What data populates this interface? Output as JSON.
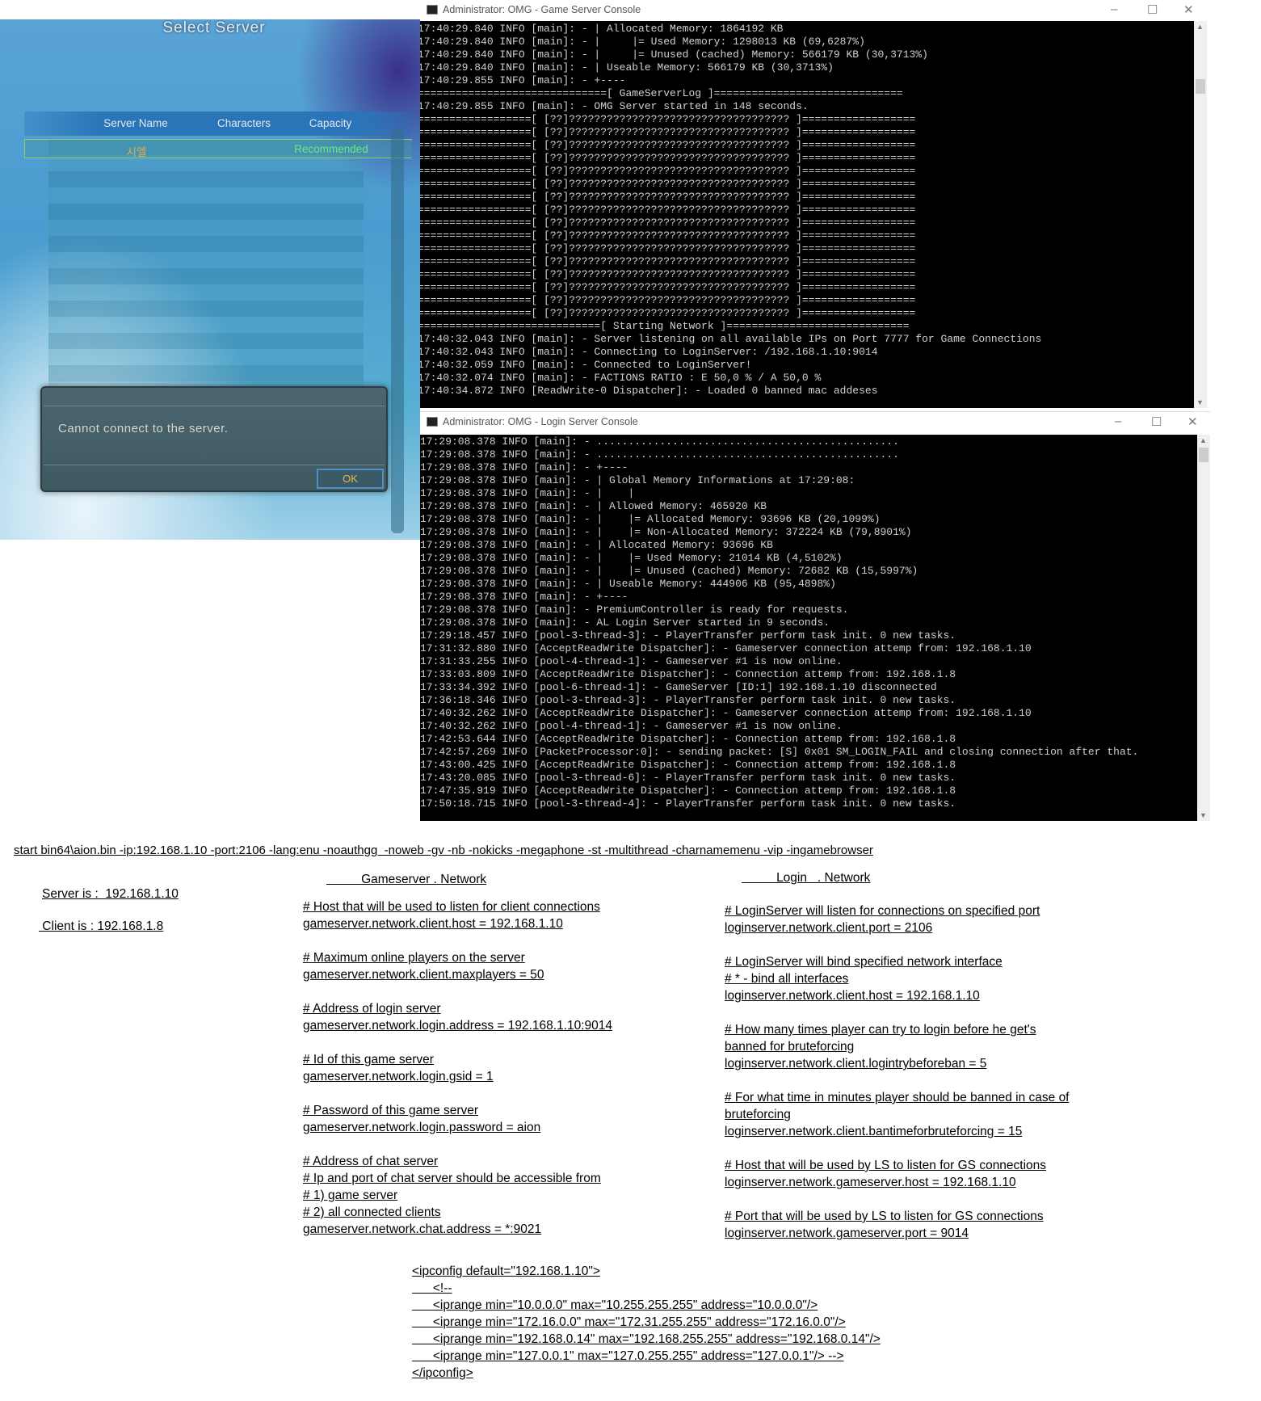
{
  "game": {
    "title": "Select Server",
    "columns": [
      "Server Name",
      "Characters",
      "Capacity"
    ],
    "server_name": "시엘",
    "server_status": "Recommended",
    "dialog_message": "Cannot connect to the server.",
    "ok_label": "OK"
  },
  "gs_console": {
    "title": "Administrator:  OMG - Game Server Console",
    "lines": [
      "17:40:29.840 INFO [main]: - | Allocated Memory: 1864192 KB",
      "17:40:29.840 INFO [main]: - |     |= Used Memory: 1298013 KB (69,6287%)",
      "17:40:29.840 INFO [main]: - |     |= Unused (cached) Memory: 566179 KB (30,3713%)",
      "17:40:29.840 INFO [main]: - | Useable Memory: 566179 KB (30,3713%)",
      "17:40:29.855 INFO [main]: - +----",
      "==============================[ GameServerLog ]==============================",
      "17:40:29.855 INFO [main]: - OMG Server started in 148 seconds.",
      "==================[ [??]??????????????????????????????????? ]==================",
      "==================[ [??]??????????????????????????????????? ]==================",
      "==================[ [??]??????????????????????????????????? ]==================",
      "==================[ [??]??????????????????????????????????? ]==================",
      "==================[ [??]??????????????????????????????????? ]==================",
      "==================[ [??]??????????????????????????????????? ]==================",
      "==================[ [??]??????????????????????????????????? ]==================",
      "==================[ [??]??????????????????????????????????? ]==================",
      "==================[ [??]??????????????????????????????????? ]==================",
      "==================[ [??]??????????????????????????????????? ]==================",
      "==================[ [??]??????????????????????????????????? ]==================",
      "==================[ [??]??????????????????????????????????? ]==================",
      "==================[ [??]??????????????????????????????????? ]==================",
      "==================[ [??]??????????????????????????????????? ]==================",
      "==================[ [??]??????????????????????????????????? ]==================",
      "==================[ [??]??????????????????????????????????? ]==================",
      "=============================[ Starting Network ]=============================",
      "17:40:32.043 INFO [main]: - Server listening on all available IPs on Port 7777 for Game Connections",
      "17:40:32.043 INFO [main]: - Connecting to LoginServer: /192.168.1.10:9014",
      "17:40:32.059 INFO [main]: - Connected to LoginServer!",
      "17:40:32.074 INFO [main]: - FACTIONS RATIO : E 50,0 % / A 50,0 %",
      "17:40:34.872 INFO [ReadWrite-0 Dispatcher]: - Loaded 0 banned mac addeses"
    ]
  },
  "ls_console": {
    "title": "Administrator:  OMG - Login Server Console",
    "lines": [
      "17:29:08.378 INFO [main]: - ................................................",
      "17:29:08.378 INFO [main]: - ................................................",
      "17:29:08.378 INFO [main]: - +----",
      "17:29:08.378 INFO [main]: - | Global Memory Informations at 17:29:08:",
      "17:29:08.378 INFO [main]: - |    |",
      "17:29:08.378 INFO [main]: - | Allowed Memory: 465920 KB",
      "17:29:08.378 INFO [main]: - |    |= Allocated Memory: 93696 KB (20,1099%)",
      "17:29:08.378 INFO [main]: - |    |= Non-Allocated Memory: 372224 KB (79,8901%)",
      "17:29:08.378 INFO [main]: - | Allocated Memory: 93696 KB",
      "17:29:08.378 INFO [main]: - |    |= Used Memory: 21014 KB (4,5102%)",
      "17:29:08.378 INFO [main]: - |    |= Unused (cached) Memory: 72682 KB (15,5997%)",
      "17:29:08.378 INFO [main]: - | Useable Memory: 444906 KB (95,4898%)",
      "17:29:08.378 INFO [main]: - +----",
      "17:29:08.378 INFO [main]: - PremiumController is ready for requests.",
      "17:29:08.378 INFO [main]: - AL Login Server started in 9 seconds.",
      "17:29:18.457 INFO [pool-3-thread-3]: - PlayerTransfer perform task init. 0 new tasks.",
      "17:31:32.880 INFO [AcceptReadWrite Dispatcher]: - Gameserver connection attemp from: 192.168.1.10",
      "17:31:33.255 INFO [pool-4-thread-1]: - Gameserver #1 is now online.",
      "17:33:03.809 INFO [AcceptReadWrite Dispatcher]: - Connection attemp from: 192.168.1.8",
      "17:33:34.392 INFO [pool-6-thread-1]: - GameServer [ID:1] 192.168.1.10 disconnected",
      "17:36:18.346 INFO [pool-3-thread-3]: - PlayerTransfer perform task init. 0 new tasks.",
      "17:40:32.262 INFO [AcceptReadWrite Dispatcher]: - Gameserver connection attemp from: 192.168.1.10",
      "17:40:32.262 INFO [pool-4-thread-1]: - Gameserver #1 is now online.",
      "17:42:53.644 INFO [AcceptReadWrite Dispatcher]: - Connection attemp from: 192.168.1.8",
      "17:42:57.269 INFO [PacketProcessor:0]: - sending packet: [S] 0x01 SM_LOGIN_FAIL and closing connection after that.",
      "17:43:00.425 INFO [AcceptReadWrite Dispatcher]: - Connection attemp from: 192.168.1.8",
      "17:43:20.085 INFO [pool-3-thread-6]: - PlayerTransfer perform task init. 0 new tasks.",
      "17:47:35.919 INFO [AcceptReadWrite Dispatcher]: - Connection attemp from: 192.168.1.8",
      "17:50:18.715 INFO [pool-3-thread-4]: - PlayerTransfer perform task init. 0 new tasks."
    ]
  },
  "notes": {
    "command": "start bin64\\aion.bin -ip:192.168.1.10 -port:2106 -lang:enu -noauthgg  -noweb -gv -nb -nokicks -megaphone -st -multithread -charnamemenu -vip -ingamebrowser",
    "server_is": "Server is :  192.168.1.10",
    "client_is": " Client is : 192.168.1.8",
    "gs_header": "          Gameserver . Network",
    "ls_header": "          Login   . Network",
    "gs_groups": [
      [
        "# Host that will be used to listen for client connections",
        "gameserver.network.client.host = 192.168.1.10"
      ],
      [
        "# Maximum online players on the server",
        "gameserver.network.client.maxplayers = 50"
      ],
      [
        "# Address of login server",
        "gameserver.network.login.address = 192.168.1.10:9014"
      ],
      [
        "# Id of this game server",
        "gameserver.network.login.gsid = 1"
      ],
      [
        "# Password of this game server",
        "gameserver.network.login.password = aion"
      ],
      [
        "# Address of chat server",
        "# Ip and port of chat server should be accessible from",
        "# 1) game server",
        "# 2) all connected clients",
        "gameserver.network.chat.address = *:9021"
      ]
    ],
    "ls_groups": [
      [
        "# LoginServer will listen for connections on specified port",
        "loginserver.network.client.port = 2106"
      ],
      [
        "# LoginServer will bind specified network interface",
        "# * - bind all interfaces",
        "loginserver.network.client.host = 192.168.1.10"
      ],
      [
        "# How many times player can try to login before he get's",
        "banned for bruteforcing",
        "loginserver.network.client.logintrybeforeban = 5"
      ],
      [
        "# For what time in minutes player should be banned in case of",
        "bruteforcing",
        "loginserver.network.client.bantimeforbruteforcing = 15"
      ],
      [
        "# Host that will be used by LS to listen for GS connections",
        "loginserver.network.gameserver.host = 192.168.1.10"
      ],
      [
        "# Port that will be used by LS to listen for GS connections",
        "loginserver.network.gameserver.port = 9014"
      ]
    ],
    "ipconfig": [
      "<ipconfig default=\"192.168.1.10\">",
      "      <!--",
      "      <iprange min=\"10.0.0.0\" max=\"10.255.255.255\" address=\"10.0.0.0\"/>",
      "      <iprange min=\"172.16.0.0\" max=\"172.31.255.255\" address=\"172.16.0.0\"/>",
      "      <iprange min=\"192.168.0.14\" max=\"192.168.255.255\" address=\"192.168.0.14\"/>",
      "      <iprange min=\"127.0.0.1\" max=\"127.0.255.255\" address=\"127.0.0.1\"/> -->",
      "</ipconfig>"
    ]
  }
}
